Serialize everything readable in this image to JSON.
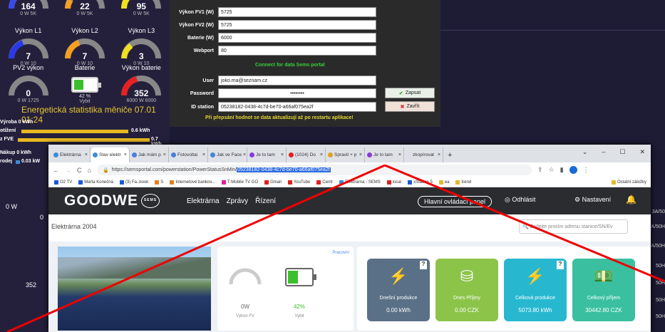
{
  "dashboard": {
    "gauges_top": [
      {
        "value": "164",
        "scale": "0    W    5K"
      },
      {
        "value": "22",
        "scale": "0    W    5K"
      },
      {
        "value": "95",
        "scale": "0    W    5K"
      }
    ],
    "labels_row1": [
      "Výkon L1",
      "Výkon L2",
      "Výkon L3"
    ],
    "gauges_mid": [
      {
        "value": "7",
        "scale": "0    W    10"
      },
      {
        "value": "7",
        "scale": "0    W    10"
      },
      {
        "value": "3",
        "scale": "0    W    10"
      }
    ],
    "labels_row2": [
      "PV2 výkon",
      "Baterie",
      "Výkon baterie"
    ],
    "pv2": {
      "value": "0",
      "scale": "0     W     1725"
    },
    "battery": {
      "percent": "42 %",
      "sub": "Vybit",
      "level": 42
    },
    "bat_power": {
      "value": "352",
      "scale": "6000   W   6000"
    },
    "energy_title": "Energetická statistika měniče 07.01 01:24",
    "stats": [
      {
        "label": "Výroba 0 kWh"
      },
      {
        "label": "otížení",
        "value": "0.6 kWh"
      },
      {
        "label": "z FVE",
        "value": "0.7 kWh"
      },
      {
        "label": "Nákup 0 kWh"
      },
      {
        "label": "rodej",
        "value": "0.03 kW"
      }
    ],
    "left_partial": [
      "0 W",
      "0",
      "352"
    ]
  },
  "config": {
    "fields": [
      {
        "label": "Výkon FV1 (W)",
        "value": "5725"
      },
      {
        "label": "Výkon FV2 (W)",
        "value": "5725"
      },
      {
        "label": "Baterie (W)",
        "value": "6000"
      },
      {
        "label": "Webport",
        "value": "80"
      }
    ],
    "connect_text": "Connect for data Sems portal",
    "user_label": "User",
    "user_value": "joko.ma@seznam.cz",
    "password_label": "Password",
    "password_value": "••••••••",
    "id_label": "ID station",
    "id_value": "05238182-0438-4c7d-be70-a66af075ea2f",
    "save_label": "Zapsat",
    "close_label": "Zavřít",
    "warning": "Při přepsání hodnot se data aktualizují až po restartu aplikace!"
  },
  "right_labels": [
    "3A/50",
    "A/50H",
    "A/50H",
    "50H",
    "50H",
    "50H",
    "50H"
  ],
  "browser": {
    "tabs": [
      "Elektrárna",
      "Stav elektr",
      "Jak mám p",
      "Fotovoltai",
      "Jak ve Face",
      "Je to tam",
      "(1024) Do",
      "Spravit + p",
      "Je to tam",
      "zkopírovat"
    ],
    "url_prefix": "https://semsportal.com/powerstation/PowerStatusSnMin/",
    "url_selected": "05238182-0438-4c7d-be70-a66af075ea2f",
    "bookmarks": [
      "O2 TV",
      "Marta Konečná",
      "(3) Fa..book",
      "S",
      "Internetové bankov...",
      "T-Mobile TV GO",
      "Gmail",
      "YouTube",
      "Centr",
      "Elektrárna - SEMS",
      "local",
      "xStation 5",
      "ea",
      "trend",
      "Ostatní záložky"
    ],
    "nav": {
      "logo": "GOODWE",
      "badge": "SEMS",
      "items": [
        "Elektrárna",
        "Zprávy",
        "Řízení"
      ],
      "main_panel": "Hlavní ovládací panel",
      "logout": "Odhlásit",
      "settings": "Nastavení"
    },
    "plant_name": "Elektrárna 2004",
    "search_placeholder": "Zadejte prosím adresu stanice/SN/Ev",
    "status": "Pracovní",
    "pv_value": "0W",
    "pv_label": "Výkon FV",
    "bat_value": "42%",
    "bat_label": "Vybit",
    "bat_level": 42,
    "tiles": [
      {
        "title": "Dnešní produkce",
        "value": "0.00 kWh",
        "color": "#5a7086",
        "icon": "⚡"
      },
      {
        "title": "Dnes Příjmy",
        "value": "0.00 CZK",
        "color": "#8cc44a",
        "icon": "⛁"
      },
      {
        "title": "Celková produkce",
        "value": "5073.80 kWh",
        "color": "#27b8d0",
        "icon": "⚡"
      },
      {
        "title": "Celkový příjem",
        "value": "30442.80 CZK",
        "color": "#3ac0a0",
        "icon": "💵"
      }
    ]
  }
}
